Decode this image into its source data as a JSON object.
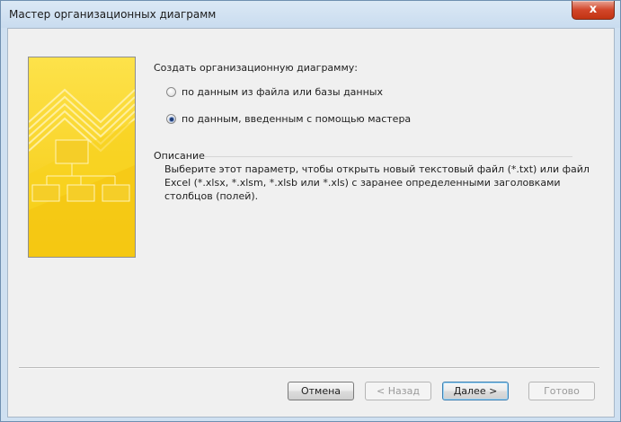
{
  "window": {
    "title": "Мастер организационных диаграмм",
    "close_glyph": "x"
  },
  "main": {
    "prompt": "Создать организационную диаграмму:",
    "options": [
      {
        "label": "по данным из файла или базы данных",
        "checked": false
      },
      {
        "label": "по данным, введенным с помощью мастера",
        "checked": true
      }
    ],
    "description_title": "Описание",
    "description_text": "Выберите этот параметр, чтобы открыть новый текстовый файл (*.txt) или файл Excel (*.xlsx, *.xlsm, *.xlsb или *.xls) с заранее определенными заголовками столбцов (полей)."
  },
  "buttons": {
    "cancel": "Отмена",
    "back": "< Назад",
    "next": "Далее >",
    "finish": "Готово"
  },
  "colors": {
    "art_yellow": "#f7d21c",
    "art_yellow_light": "#fde97a",
    "accent_blue": "#3c7fb1"
  },
  "icons": {
    "close": "close-icon",
    "side_art": "org-chart-illustration"
  }
}
